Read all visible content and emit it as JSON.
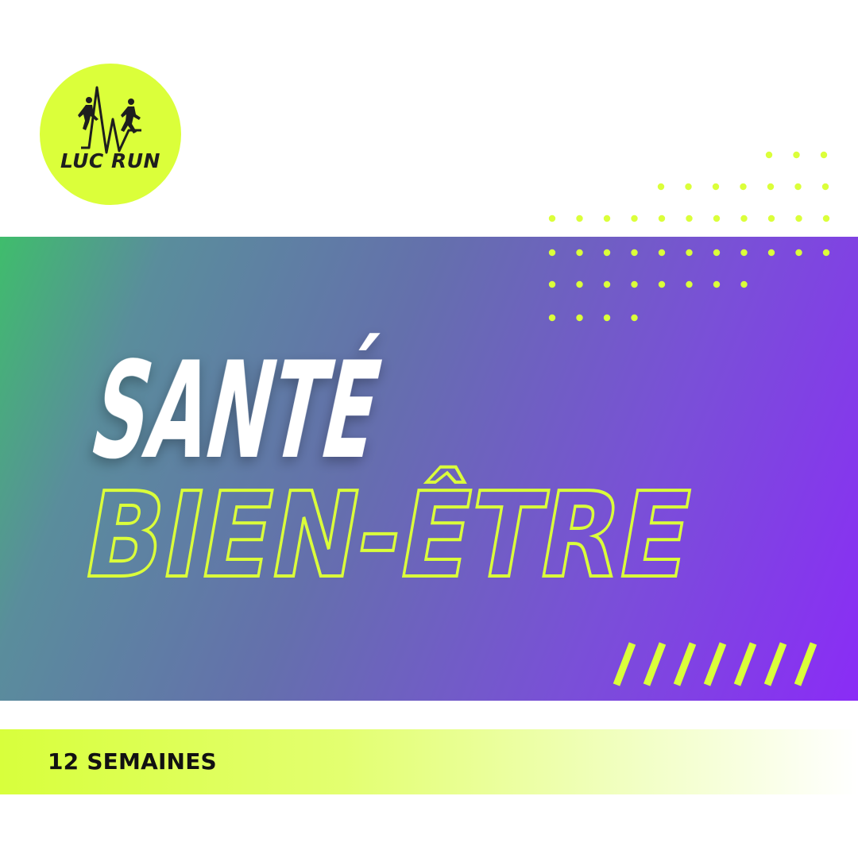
{
  "logo": {
    "text": "LUC RUN",
    "icon": "runners-heartbeat-icon"
  },
  "title": {
    "line1": "SANTÉ",
    "line2": "BIEN-ÊTRE"
  },
  "footer": {
    "weeks_label": "12 SEMAINES"
  },
  "colors": {
    "accent": "#dbff3a",
    "band_start": "#3fbd6c",
    "band_end": "#8a2cf6",
    "text_dark": "#111111",
    "text_light": "#ffffff"
  }
}
